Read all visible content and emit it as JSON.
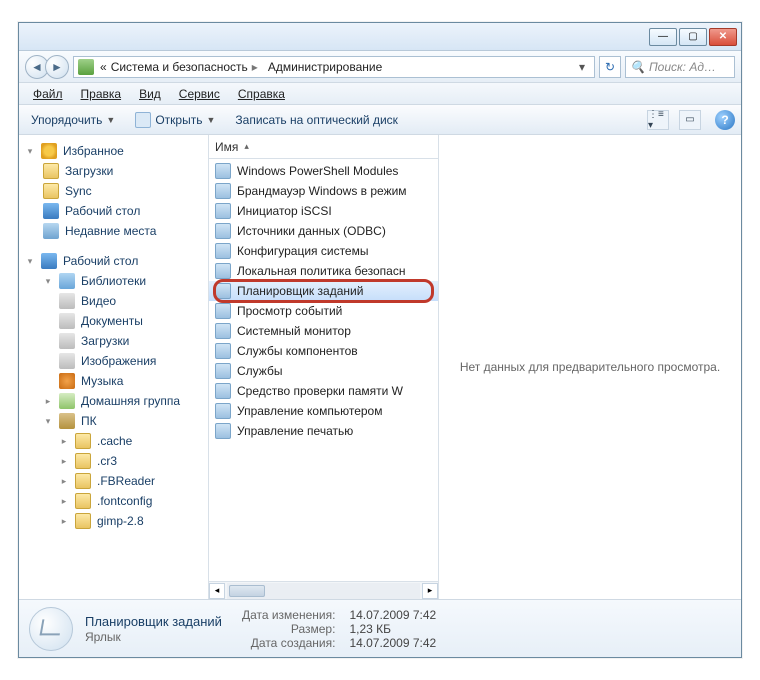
{
  "titlebar": {
    "min": "—",
    "max": "▢",
    "close": "✕"
  },
  "address": {
    "back": "◄",
    "forward": "►",
    "crumbs": [
      {
        "label": "Система и безопасность"
      },
      {
        "label": "Администрирование"
      }
    ],
    "drop": "▾",
    "refresh": "↻",
    "search_placeholder": "Поиск: Ад…"
  },
  "menu": {
    "file": "Файл",
    "edit": "Правка",
    "view": "Вид",
    "tools": "Сервис",
    "help": "Справка"
  },
  "toolbar": {
    "organize": "Упорядочить",
    "open": "Открыть",
    "burn": "Записать на оптический диск",
    "help": "?"
  },
  "sidebar": {
    "favorites": "Избранное",
    "downloads": "Загрузки",
    "sync": "Sync",
    "desktop": "Рабочий стол",
    "recent": "Недавние места",
    "desktop_root": "Рабочий стол",
    "libraries": "Библиотеки",
    "video": "Видео",
    "documents": "Документы",
    "downloads2": "Загрузки",
    "pictures": "Изображения",
    "music": "Музыка",
    "homegroup": "Домашняя группа",
    "pc": "ПК",
    "cache": ".cache",
    "cr3": ".cr3",
    "fbreader": ".FBReader",
    "fontconfig": ".fontconfig",
    "gimp": "gimp-2.8"
  },
  "list": {
    "header": "Имя",
    "items": [
      "Windows PowerShell Modules",
      "Брандмауэр Windows в режим",
      "Инициатор iSCSI",
      "Источники данных (ODBC)",
      "Конфигурация системы",
      "Локальная политика безопасн",
      "Планировщик заданий",
      "Просмотр событий",
      "Системный монитор",
      "Службы компонентов",
      "Службы",
      "Средство проверки памяти W",
      "Управление компьютером",
      "Управление печатью"
    ],
    "selected_index": 6
  },
  "preview": {
    "empty": "Нет данных для предварительного просмотра."
  },
  "details": {
    "title": "Планировщик заданий",
    "type": "Ярлык",
    "modified_k": "Дата изменения:",
    "modified_v": "14.07.2009 7:42",
    "size_k": "Размер:",
    "size_v": "1,23 КБ",
    "created_k": "Дата создания:",
    "created_v": "14.07.2009 7:42"
  }
}
